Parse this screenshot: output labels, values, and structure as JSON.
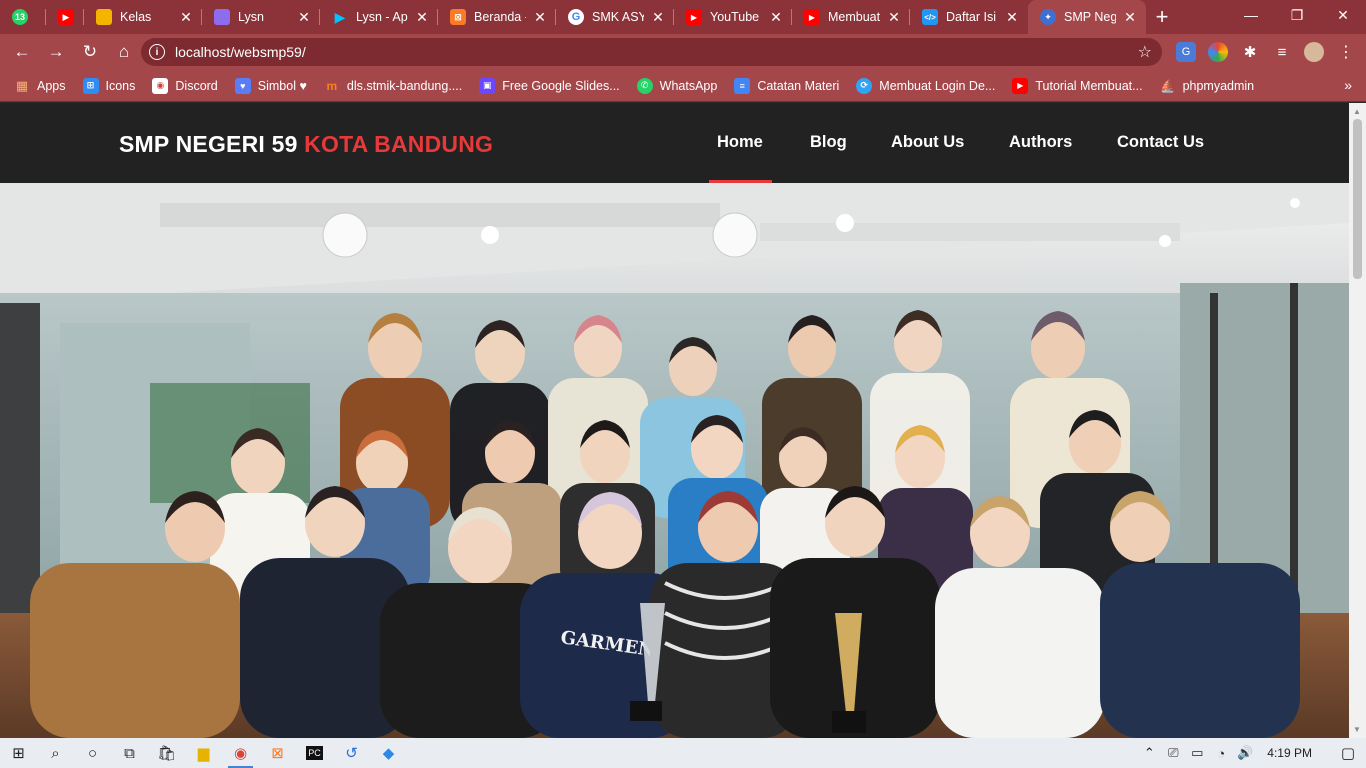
{
  "browser": {
    "tabs": [
      {
        "title": "",
        "icon": "whatsapp-icon",
        "color": "#25d366",
        "badge": "13"
      },
      {
        "title": "",
        "icon": "youtube-icon",
        "color": "#ff0000"
      },
      {
        "title": "Kelas",
        "icon": "classroom-icon",
        "color": "#f4b400"
      },
      {
        "title": "Lysn",
        "icon": "lysn-icon",
        "color": "#8e6cf0"
      },
      {
        "title": "Lysn - Apl",
        "icon": "google-play-icon",
        "color": "#00c3ff"
      },
      {
        "title": "Beranda -",
        "icon": "xampp-icon",
        "color": "#fb7a24"
      },
      {
        "title": "SMK ASY-",
        "icon": "google-icon",
        "color": "#ffffff"
      },
      {
        "title": "YouTube",
        "icon": "youtube-icon",
        "color": "#ff0000"
      },
      {
        "title": "Membuat",
        "icon": "youtube-icon",
        "color": "#ff0000"
      },
      {
        "title": "Daftar Isi",
        "icon": "code-icon",
        "color": "#2196f3"
      },
      {
        "title": "SMP Neg",
        "icon": "school-logo-icon",
        "color": "#3f6fd1",
        "active": true
      }
    ],
    "url": "localhost/websmp59/",
    "bookmarks": [
      {
        "label": "Apps",
        "icon": "apps-grid-icon",
        "color": "#e8453c"
      },
      {
        "label": "Icons",
        "icon": "icons-icon",
        "color": "#2f8cf5"
      },
      {
        "label": "Discord",
        "icon": "discord-icon",
        "color": "#d93b3b"
      },
      {
        "label": "Simbol ♥",
        "icon": "heart-icon",
        "color": "#5b7cf7"
      },
      {
        "label": "dls.stmik-bandung....",
        "icon": "moodle-icon",
        "color": "#f98012"
      },
      {
        "label": "Free Google Slides...",
        "icon": "slides-icon",
        "color": "#6b48ff"
      },
      {
        "label": "WhatsApp",
        "icon": "whatsapp-icon",
        "color": "#25d366"
      },
      {
        "label": "Catatan Materi",
        "icon": "docs-icon",
        "color": "#4285f4"
      },
      {
        "label": "Membuat Login De...",
        "icon": "site-icon",
        "color": "#2fa3f5"
      },
      {
        "label": "Tutorial Membuat...",
        "icon": "youtube-icon",
        "color": "#ff0000"
      },
      {
        "label": "phpmyadmin",
        "icon": "phpmyadmin-icon",
        "color": "#f0a020"
      }
    ]
  },
  "site": {
    "brand_main": "SMP NEGERI 59",
    "brand_accent": "KOTA BANDUNG",
    "accent_color": "#e5393a",
    "nav": [
      {
        "label": "Home",
        "active": true
      },
      {
        "label": "Blog"
      },
      {
        "label": "About Us"
      },
      {
        "label": "Authors"
      },
      {
        "label": "Contact Us"
      }
    ]
  },
  "taskbar": {
    "time": "4:19 PM"
  }
}
